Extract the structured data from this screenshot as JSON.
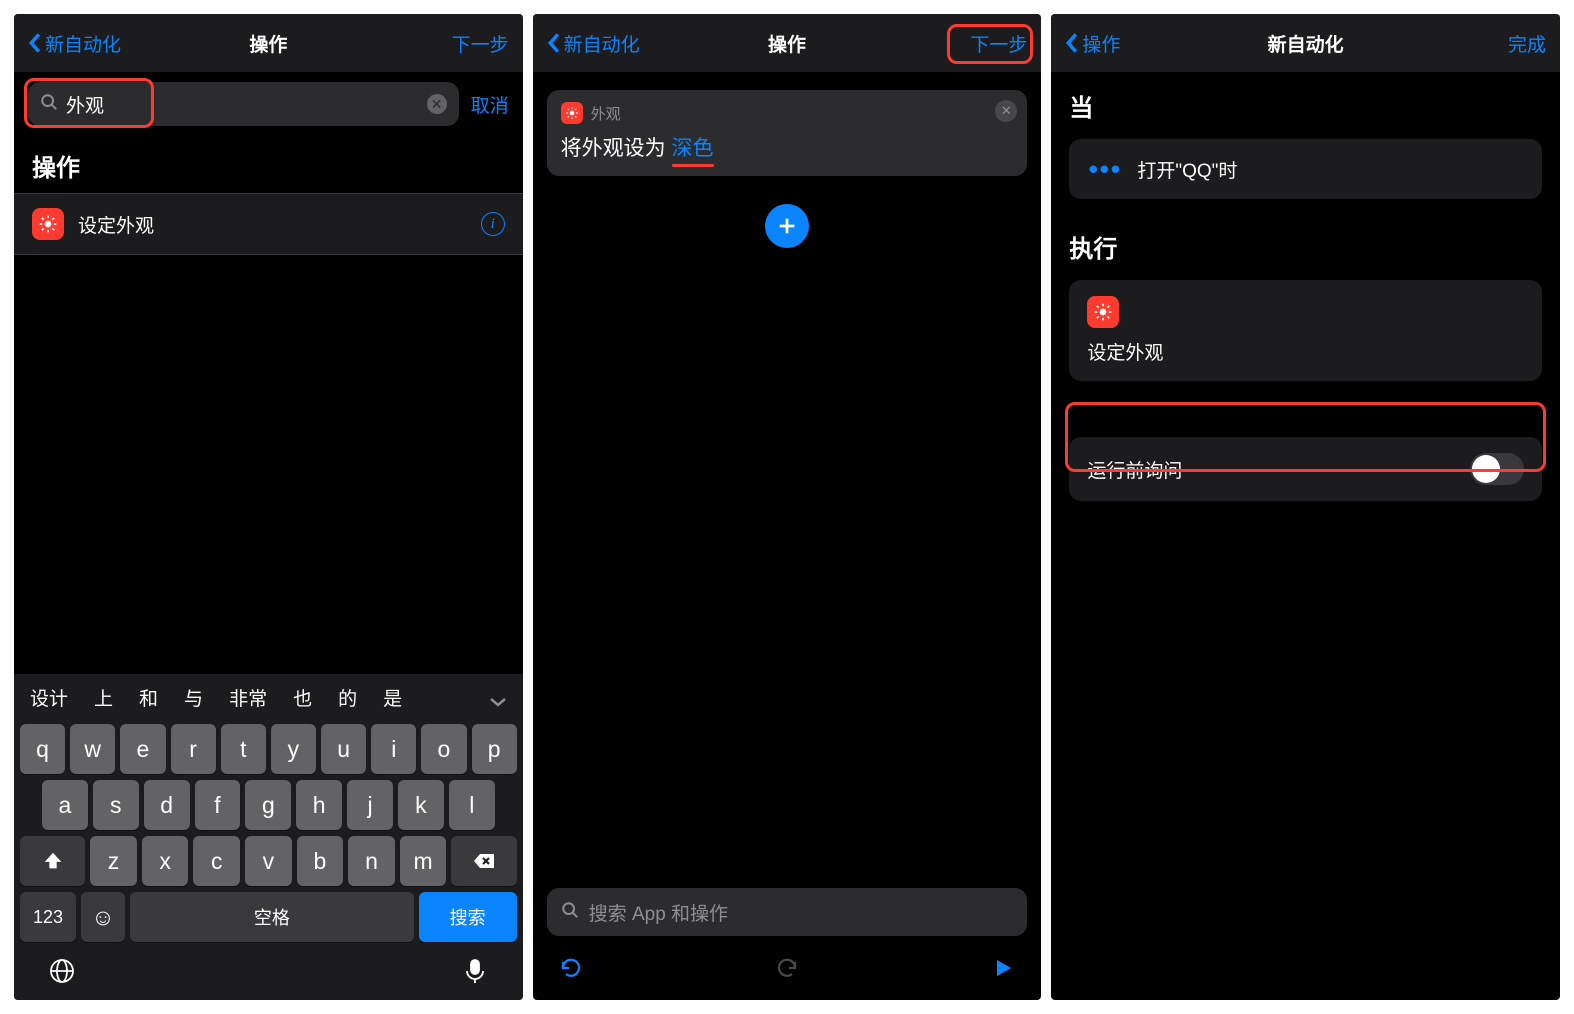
{
  "panel1": {
    "nav": {
      "back": "新自动化",
      "title": "操作",
      "next": "下一步"
    },
    "search": {
      "value": "外观",
      "cancel": "取消"
    },
    "section_title": "操作",
    "result": {
      "label": "设定外观"
    },
    "candidates": [
      "设计",
      "上",
      "和",
      "与",
      "非常",
      "也",
      "的",
      "是"
    ],
    "kb": {
      "r1": [
        "q",
        "w",
        "e",
        "r",
        "t",
        "y",
        "u",
        "i",
        "o",
        "p"
      ],
      "r2": [
        "a",
        "s",
        "d",
        "f",
        "g",
        "h",
        "j",
        "k",
        "l"
      ],
      "r3": [
        "z",
        "x",
        "c",
        "v",
        "b",
        "n",
        "m"
      ],
      "num": "123",
      "space": "空格",
      "search": "搜索"
    }
  },
  "panel2": {
    "nav": {
      "back": "新自动化",
      "title": "操作",
      "next": "下一步"
    },
    "card": {
      "mini_title": "外观",
      "prefix": "将外观设为 ",
      "param": "深色"
    },
    "bottom_search_placeholder": "搜索 App 和操作"
  },
  "panel3": {
    "nav": {
      "back": "操作",
      "title": "新自动化",
      "done": "完成"
    },
    "section_when": "当",
    "condition": "打开\"QQ\"时",
    "section_do": "执行",
    "action_label": "设定外观",
    "ask_label": "运行前询问"
  }
}
